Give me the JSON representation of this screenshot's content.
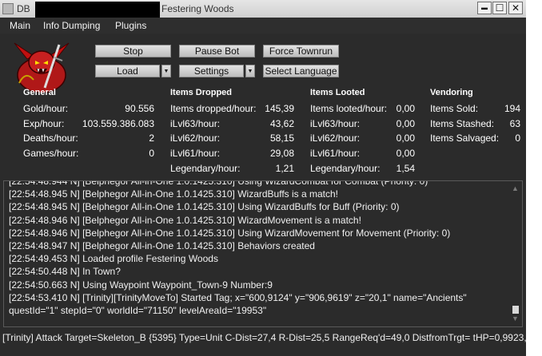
{
  "window": {
    "title_prefix": "DB",
    "title_suffix": "Festering Woods"
  },
  "window_buttons": {
    "minimize": "▬",
    "maximize": "☐",
    "close": "✕"
  },
  "menu": [
    "Main",
    "Info Dumping",
    "Plugins"
  ],
  "buttons": {
    "stop": "Stop",
    "pause": "Pause Bot",
    "townrun": "Force Townrun",
    "load": "Load",
    "settings": "Settings",
    "language": "Select Language",
    "dropdown_glyph": "▼"
  },
  "general": {
    "title": "General",
    "rows": [
      {
        "label": "Gold/hour:",
        "value": "90.556"
      },
      {
        "label": "Exp/hour:",
        "value": "103.559.386.083"
      },
      {
        "label": "Deaths/hour:",
        "value": "2"
      },
      {
        "label": "Games/hour:",
        "value": "0"
      }
    ]
  },
  "dropped": {
    "title": "Items Dropped",
    "rows": [
      {
        "label": "Items dropped/hour:",
        "value": "145,39"
      },
      {
        "label": "iLvl63/hour:",
        "value": "43,62"
      },
      {
        "label": "iLvl62/hour:",
        "value": "58,15"
      },
      {
        "label": "iLvl61/hour:",
        "value": "29,08"
      },
      {
        "label": "Legendary/hour:",
        "value": "1,21"
      }
    ]
  },
  "looted": {
    "title": "Items Looted",
    "rows": [
      {
        "label": "Items looted/hour:",
        "value": "0,00"
      },
      {
        "label": "iLvl63/hour:",
        "value": "0,00"
      },
      {
        "label": "iLvl62/hour:",
        "value": "0,00"
      },
      {
        "label": "iLvl61/hour:",
        "value": "0,00"
      },
      {
        "label": "Legendary/hour:",
        "value": "1,54"
      }
    ]
  },
  "vendoring": {
    "title": "Vendoring",
    "rows": [
      {
        "label": "Items Sold:",
        "value": "194"
      },
      {
        "label": "Items Stashed:",
        "value": "63"
      },
      {
        "label": "Items Salvaged:",
        "value": "0"
      }
    ]
  },
  "log": [
    "[22:54:48.944 N] [Belphegor All-in-One 1.0.1425.310] Using WizardCombat for Combat (Priority: 0)",
    "[22:54:48.945 N] [Belphegor All-in-One 1.0.1425.310] WizardBuffs is a match!",
    "[22:54:48.945 N] [Belphegor All-in-One 1.0.1425.310] Using WizardBuffs for Buff (Priority: 0)",
    "[22:54:48.946 N] [Belphegor All-in-One 1.0.1425.310] WizardMovement is a match!",
    "[22:54:48.946 N] [Belphegor All-in-One 1.0.1425.310] Using WizardMovement for Movement (Priority: 0)",
    "[22:54:48.947 N] [Belphegor All-in-One 1.0.1425.310] Behaviors created",
    "[22:54:49.453 N] Loaded profile Festering Woods",
    "[22:54:50.448 N] In Town?",
    "[22:54:50.663 N] Using Waypoint Waypoint_Town-9 Number:9",
    "[22:54:53.410 N] [Trinity][TrinityMoveTo] Started Tag; x=\"600,9124\" y=\"906,9619\" z=\"20,1\"  name=\"Ancients\"",
    "questId=\"1\" stepId=\"0\" worldId=\"71150\" levelAreaId=\"19953\""
  ],
  "scroll_glyphs": {
    "up": "▲",
    "down": "▼"
  },
  "status_text": "[Trinity] Attack Target=Skeleton_B {5395} Type=Unit C-Dist=27,4 R-Dist=25,5 RangeReq'd=49,0 DistfromTrgt= tHP=0,9923,"
}
